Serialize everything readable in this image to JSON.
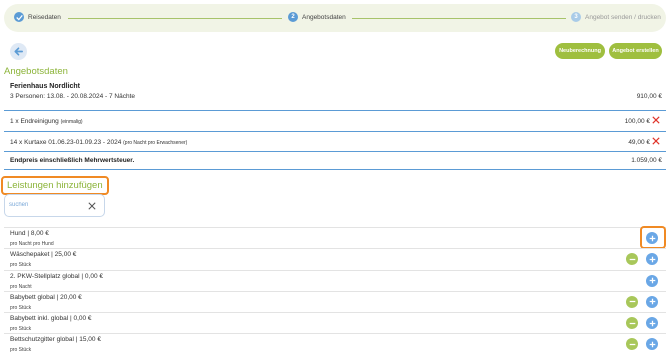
{
  "stepper": {
    "steps": [
      {
        "number": "1",
        "label": "Reisedaten",
        "state": "done"
      },
      {
        "number": "2",
        "label": "Angebotsdaten",
        "state": "active"
      },
      {
        "number": "3",
        "label": "Angebot senden / drucken",
        "state": "pending"
      }
    ]
  },
  "toolbar": {
    "back_icon": "arrow-left-icon",
    "recalc_label": "Neuberechnung",
    "create_offer_label": "Angebot erstellen"
  },
  "offer": {
    "section_title": "Angebotsdaten",
    "accommodation": {
      "name": "Ferienhaus Nordlicht",
      "details": "3 Personen: 13.08. - 20.08.2024 - 7 Nächte",
      "price": "910,00 €"
    },
    "items": [
      {
        "text": "1 x Endreinigung",
        "note": "(einmalig)",
        "price": "100,00 €"
      },
      {
        "text": "14 x Kurtaxe 01.06.23-01.09.23 - 2024",
        "note": "(pro Nacht pro Erwachsener)",
        "price": "49,00 €"
      }
    ],
    "total": {
      "label": "Endpreis einschließlich Mehrwertsteuer.",
      "price": "1.059,00 €"
    }
  },
  "services": {
    "section_title": "Leistungen hinzufügen",
    "search": {
      "placeholder": "suchen",
      "value": ""
    },
    "list": [
      {
        "name": "Hund | 8,00 €",
        "unit": "pro Nacht pro Hund",
        "has_minus": false
      },
      {
        "name": "Wäschepaket | 25,00 €",
        "unit": "pro Stück",
        "has_minus": true
      },
      {
        "name": "2. PKW-Stellplatz global | 0,00 €",
        "unit": "pro Nacht",
        "has_minus": false
      },
      {
        "name": "Babybett global | 20,00 €",
        "unit": "pro Stück",
        "has_minus": true
      },
      {
        "name": "Babybett inkl. global | 0,00 €",
        "unit": "pro Stück",
        "has_minus": true
      },
      {
        "name": "Bettschutzgitter global | 15,00 €",
        "unit": "pro Stück",
        "has_minus": true
      }
    ]
  },
  "colors": {
    "accent_green": "#8cb43a",
    "button_green": "#9fbf3f",
    "accent_blue": "#5b9bd5",
    "highlight_orange": "#f08a24",
    "remove_red": "#e0342a"
  }
}
